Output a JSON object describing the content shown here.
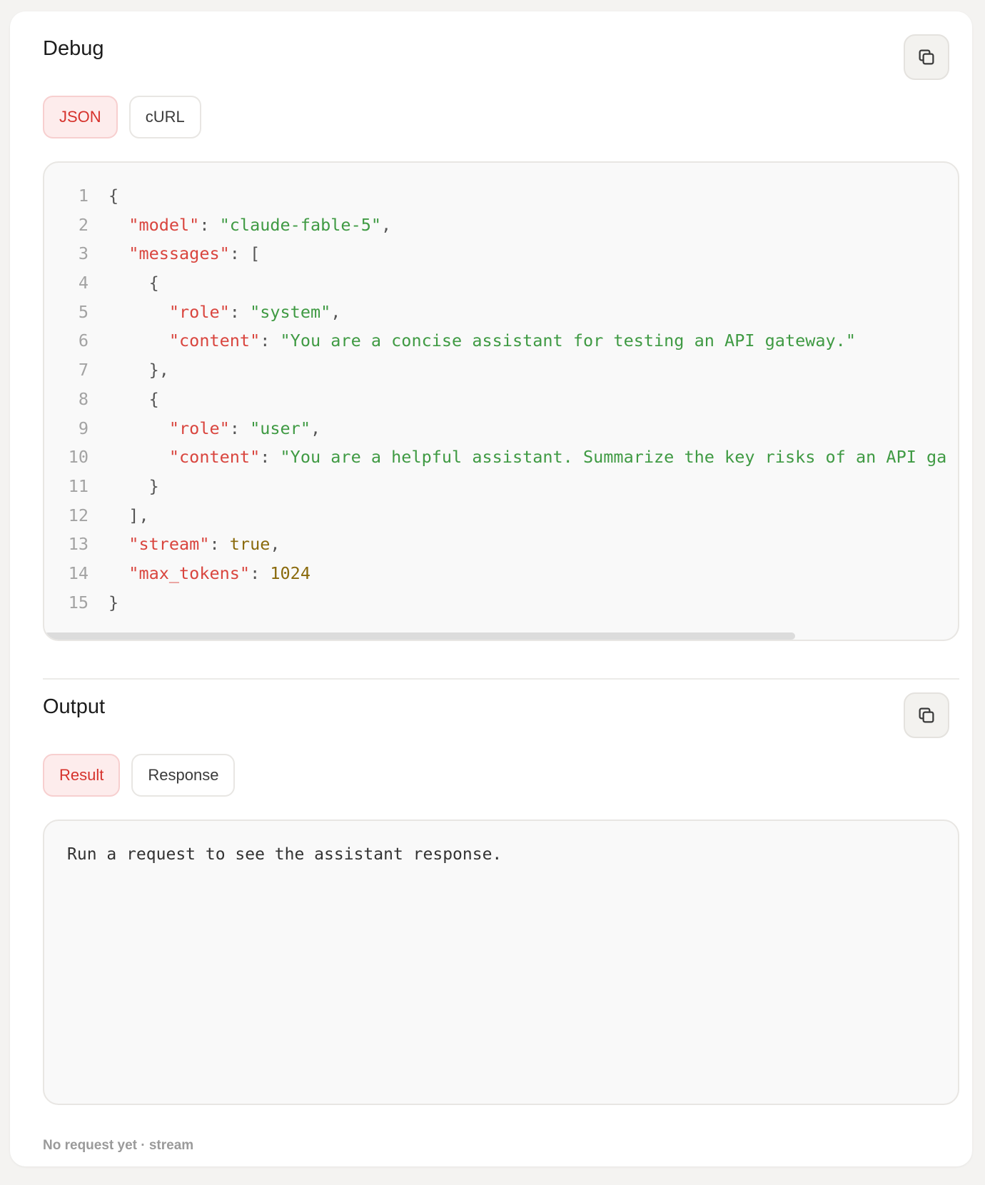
{
  "debug": {
    "title": "Debug",
    "copy_icon": "copy-icon",
    "tabs": [
      {
        "label": "JSON",
        "active": true
      },
      {
        "label": "cURL",
        "active": false
      }
    ],
    "code_lines": [
      {
        "n": "1",
        "parts": [
          {
            "t": "p",
            "v": "{"
          }
        ]
      },
      {
        "n": "2",
        "parts": [
          {
            "t": "p",
            "v": "  "
          },
          {
            "t": "k",
            "v": "\"model\""
          },
          {
            "t": "p",
            "v": ": "
          },
          {
            "t": "s",
            "v": "\"claude-fable-5\""
          },
          {
            "t": "p",
            "v": ","
          }
        ]
      },
      {
        "n": "3",
        "parts": [
          {
            "t": "p",
            "v": "  "
          },
          {
            "t": "k",
            "v": "\"messages\""
          },
          {
            "t": "p",
            "v": ": ["
          }
        ]
      },
      {
        "n": "4",
        "parts": [
          {
            "t": "p",
            "v": "    {"
          }
        ]
      },
      {
        "n": "5",
        "parts": [
          {
            "t": "p",
            "v": "      "
          },
          {
            "t": "k",
            "v": "\"role\""
          },
          {
            "t": "p",
            "v": ": "
          },
          {
            "t": "s",
            "v": "\"system\""
          },
          {
            "t": "p",
            "v": ","
          }
        ]
      },
      {
        "n": "6",
        "parts": [
          {
            "t": "p",
            "v": "      "
          },
          {
            "t": "k",
            "v": "\"content\""
          },
          {
            "t": "p",
            "v": ": "
          },
          {
            "t": "s",
            "v": "\"You are a concise assistant for testing an API gateway.\""
          }
        ]
      },
      {
        "n": "7",
        "parts": [
          {
            "t": "p",
            "v": "    },"
          }
        ]
      },
      {
        "n": "8",
        "parts": [
          {
            "t": "p",
            "v": "    {"
          }
        ]
      },
      {
        "n": "9",
        "parts": [
          {
            "t": "p",
            "v": "      "
          },
          {
            "t": "k",
            "v": "\"role\""
          },
          {
            "t": "p",
            "v": ": "
          },
          {
            "t": "s",
            "v": "\"user\""
          },
          {
            "t": "p",
            "v": ","
          }
        ]
      },
      {
        "n": "10",
        "parts": [
          {
            "t": "p",
            "v": "      "
          },
          {
            "t": "k",
            "v": "\"content\""
          },
          {
            "t": "p",
            "v": ": "
          },
          {
            "t": "s",
            "v": "\"You are a helpful assistant. Summarize the key risks of an API ga"
          }
        ]
      },
      {
        "n": "11",
        "parts": [
          {
            "t": "p",
            "v": "    }"
          }
        ]
      },
      {
        "n": "12",
        "parts": [
          {
            "t": "p",
            "v": "  ],"
          }
        ]
      },
      {
        "n": "13",
        "parts": [
          {
            "t": "p",
            "v": "  "
          },
          {
            "t": "k",
            "v": "\"stream\""
          },
          {
            "t": "p",
            "v": ": "
          },
          {
            "t": "n",
            "v": "true"
          },
          {
            "t": "p",
            "v": ","
          }
        ]
      },
      {
        "n": "14",
        "parts": [
          {
            "t": "p",
            "v": "  "
          },
          {
            "t": "k",
            "v": "\"max_tokens\""
          },
          {
            "t": "p",
            "v": ": "
          },
          {
            "t": "n",
            "v": "1024"
          }
        ]
      },
      {
        "n": "15",
        "parts": [
          {
            "t": "p",
            "v": "}"
          }
        ]
      }
    ]
  },
  "output": {
    "title": "Output",
    "copy_icon": "copy-icon",
    "tabs": [
      {
        "label": "Result",
        "active": true
      },
      {
        "label": "Response",
        "active": false
      }
    ],
    "placeholder": "Run a request to see the assistant response."
  },
  "footer": {
    "status": "No request yet · stream"
  },
  "colors": {
    "accent": "#d6322c",
    "key": "#d9453e",
    "string": "#3f9a43",
    "literal": "#8a6a0c"
  }
}
